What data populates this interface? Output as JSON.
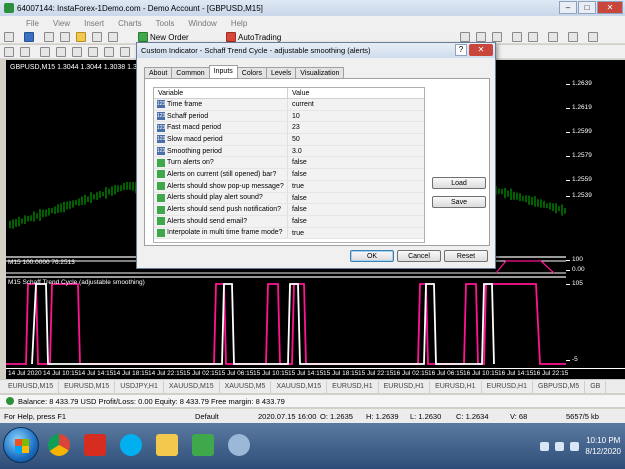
{
  "window": {
    "title": "64007144: InstaForex-1Demo.com - Demo Account - [GBPUSD,M15]",
    "controls": [
      "–",
      "□",
      "✕"
    ]
  },
  "menu": [
    "File",
    "View",
    "Insert",
    "Charts",
    "Tools",
    "Window",
    "Help"
  ],
  "toolbar": {
    "new_order": "New Order",
    "autotrading": "AutoTrading"
  },
  "chart": {
    "label": "GBPUSD,M15  1.3044 1.3044 1.3038 1.3038",
    "price_ticks": [
      "1.2639",
      "1.2619",
      "1.2599",
      "1.2579",
      "1.2559",
      "1.2539"
    ],
    "indicator1_label": "M15 100.0000 76.2513",
    "indicator1_ticks": [
      "100",
      "0.00"
    ],
    "indicator2_label": "M15 Schaff Trend Cycle (adjustable smoothing)",
    "indicator2_ticks": [
      "105",
      "-5"
    ],
    "time_ticks": [
      "14 Jul 2020",
      "14 Jul 10:15",
      "14 Jul 14:15",
      "14 Jul 18:15",
      "14 Jul 22:15",
      "15 Jul 02:15",
      "15 Jul 06:15",
      "15 Jul 10:15",
      "15 Jul 14:15",
      "15 Jul 18:15",
      "15 Jul 22:15",
      "16 Jul 02:15",
      "16 Jul 06:15",
      "16 Jul 10:15",
      "16 Jul 14:15",
      "16 Jul 22:15"
    ]
  },
  "dialog": {
    "title": "Custom Indicator - Schaff Trend Cycle - adjustable smoothing (alerts)",
    "help": "?",
    "close": "✕",
    "tabs": [
      "About",
      "Common",
      "Inputs",
      "Colors",
      "Levels",
      "Visualization"
    ],
    "active_tab": "Inputs",
    "table_header": {
      "variable": "Variable",
      "value": "Value"
    },
    "params": [
      {
        "type": "num",
        "name": "Time frame",
        "value": "current"
      },
      {
        "type": "num",
        "name": "Schaff period",
        "value": "10"
      },
      {
        "type": "num",
        "name": "Fast macd period",
        "value": "23"
      },
      {
        "type": "num",
        "name": "Slow macd period",
        "value": "50"
      },
      {
        "type": "num",
        "name": "Smoothing period",
        "value": "3.0"
      },
      {
        "type": "bool",
        "name": "Turn alerts on?",
        "value": "false"
      },
      {
        "type": "bool",
        "name": "Alerts on current (still opened) bar?",
        "value": "false"
      },
      {
        "type": "bool",
        "name": "Alerts should show pop-up message?",
        "value": "true"
      },
      {
        "type": "bool",
        "name": "Alerts should play alert sound?",
        "value": "false"
      },
      {
        "type": "bool",
        "name": "Alerts should send push notification?",
        "value": "false"
      },
      {
        "type": "bool",
        "name": "Alerts should send email?",
        "value": "false"
      },
      {
        "type": "bool",
        "name": "Interpolate in multi time frame mode?",
        "value": "true"
      }
    ],
    "load": "Load",
    "save": "Save",
    "ok": "OK",
    "cancel": "Cancel",
    "reset": "Reset"
  },
  "symbol_tabs": [
    "EURUSD,M15",
    "EURUSD,M15",
    "USDJPY,H1",
    "XAUUSD,M15",
    "XAUUSD,M5",
    "XAUUSD,M15",
    "EURUSD,H1",
    "EURUSD,H1",
    "EURUSD,H1",
    "EURUSD,H1",
    "GBPUSD,M5",
    "GB"
  ],
  "account": {
    "text": "Balance: 8 433.79 USD  Profit/Loss: 0.00  Equity: 8 433.79  Free margin: 8 433.79"
  },
  "status": {
    "help": "For Help, press F1",
    "profile": "Default",
    "datetime": "2020.07.15 16:00",
    "open": "O: 1.2635",
    "high": "H: 1.2639",
    "low": "L: 1.2630",
    "close": "C: 1.2634",
    "volume": "V: 68",
    "traffic": "5657/5 kb"
  },
  "taskbar": {
    "time": "10:10 PM",
    "date": "8/12/2020"
  },
  "colors": {
    "chart_bg": "#000000",
    "candles": "#00c000",
    "stc_line": "#ff1493",
    "stc_white": "#ffffff",
    "accent": "#c9463d"
  }
}
